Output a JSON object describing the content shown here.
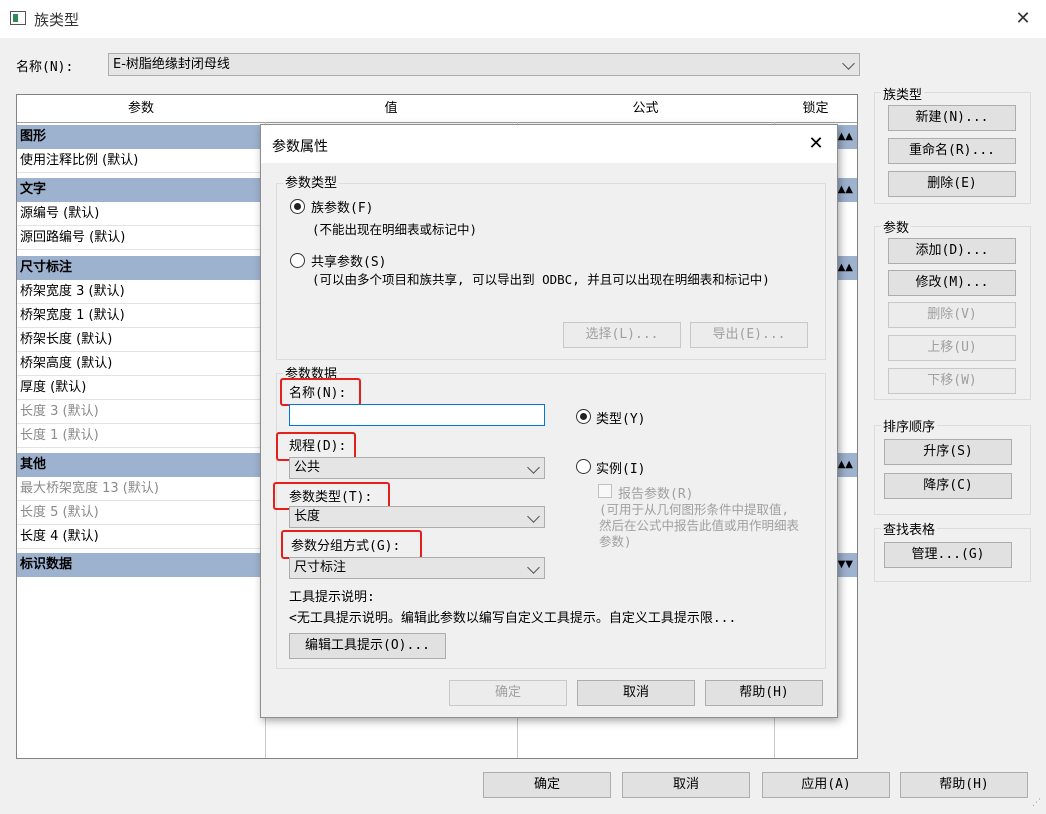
{
  "window": {
    "title": "族类型",
    "close": "✕"
  },
  "name_row": {
    "label": "名称(N):",
    "value": "E-树脂绝缘封闭母线"
  },
  "table": {
    "headers": [
      "参数",
      "值",
      "公式",
      "锁定"
    ],
    "groups": {
      "graphics": {
        "label": "图形",
        "rows": [
          "使用注释比例 (默认)"
        ]
      },
      "text": {
        "label": "文字",
        "rows": [
          "源编号 (默认)",
          "源回路编号 (默认)"
        ]
      },
      "dimensions": {
        "label": "尺寸标注",
        "rows": [
          "桥架宽度 3 (默认)",
          "桥架宽度 1 (默认)",
          "桥架长度 (默认)",
          "桥架高度 (默认)",
          "厚度 (默认)",
          "长度 3 (默认)",
          "长度 1 (默认)"
        ]
      },
      "other": {
        "label": "其他",
        "rows": [
          "最大桥架宽度 13 (默认)",
          "长度 5 (默认)",
          "长度 4 (默认)"
        ]
      },
      "identity": {
        "label": "标识数据"
      }
    }
  },
  "right_panel": {
    "family_types": {
      "label": "族类型",
      "new": "新建(N)...",
      "rename": "重命名(R)...",
      "delete": "删除(E)"
    },
    "parameters": {
      "label": "参数",
      "add": "添加(D)...",
      "modify": "修改(M)...",
      "remove": "删除(V)",
      "up": "上移(U)",
      "down": "下移(W)"
    },
    "sort": {
      "label": "排序顺序",
      "asc": "升序(S)",
      "desc": "降序(C)"
    },
    "lookup": {
      "label": "查找表格",
      "manage": "管理...(G)"
    }
  },
  "bottom": {
    "ok": "确定",
    "cancel": "取消",
    "apply": "应用(A)",
    "help": "帮助(H)"
  },
  "dialog": {
    "title": "参数属性",
    "param_type": {
      "label": "参数类型",
      "family": "族参数(F)",
      "family_note": "(不能出现在明细表或标记中)",
      "shared": "共享参数(S)",
      "shared_note": "(可以由多个项目和族共享, 可以导出到 ODBC, 并且可以出现在明细表和标记中)",
      "select": "选择(L)...",
      "export": "导出(E)..."
    },
    "param_data": {
      "label": "参数数据",
      "name_label": "名称(N):",
      "name_value": "",
      "discipline_label": "规程(D):",
      "discipline_value": "公共",
      "type_label": "参数类型(T):",
      "type_value": "长度",
      "group_label": "参数分组方式(G):",
      "group_value": "尺寸标注",
      "type_radio": "类型(Y)",
      "instance_radio": "实例(I)",
      "report": "报告参数(R)",
      "report_note": "(可用于从几何图形条件中提取值, 然后在公式中报告此值或用作明细表参数)",
      "tooltip_label": "工具提示说明:",
      "tooltip_text": "<无工具提示说明。编辑此参数以编写自定义工具提示。自定义工具提示限...",
      "edit_tooltip": "编辑工具提示(O)..."
    },
    "ok": "确定",
    "cancel": "取消",
    "help": "帮助(H)"
  }
}
